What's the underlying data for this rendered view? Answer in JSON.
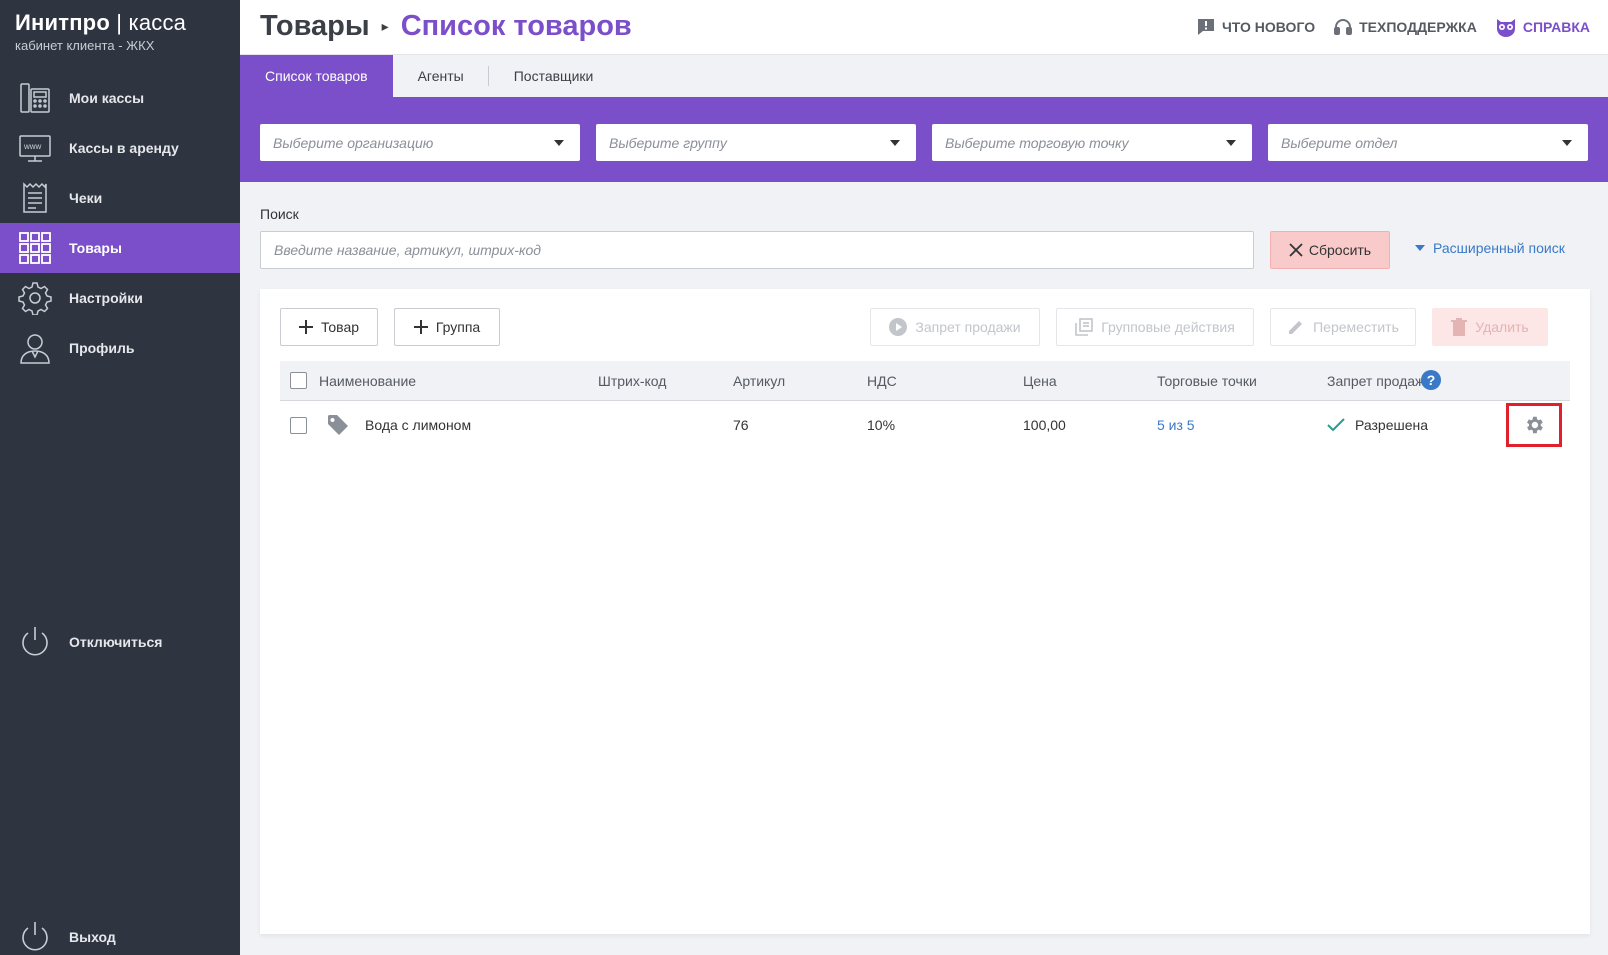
{
  "sidebar": {
    "brand_main": "Инитпро",
    "brand_sep": " | ",
    "brand_sub_word": "касса",
    "brand_subtitle": "кабинет клиента - ЖКХ",
    "items": [
      {
        "label": "Мои кассы",
        "icon": "cash-register-icon"
      },
      {
        "label": "Кассы в аренду",
        "icon": "www-terminal-icon"
      },
      {
        "label": "Чеки",
        "icon": "receipt-icon"
      },
      {
        "label": "Товары",
        "icon": "grid-icon",
        "active": true
      },
      {
        "label": "Настройки",
        "icon": "gear-icon"
      },
      {
        "label": "Профиль",
        "icon": "user-icon"
      }
    ],
    "disconnect_label": "Отключиться",
    "logout_label": "Выход"
  },
  "header": {
    "breadcrumb_root": "Товары",
    "breadcrumb_sep": "▸",
    "breadcrumb_current": "Список товаров",
    "links": {
      "news": "ЧТО НОВОГО",
      "support": "ТЕХПОДДЕРЖКА",
      "help": "СПРАВКА"
    }
  },
  "tabs": [
    {
      "label": "Список товаров",
      "active": true
    },
    {
      "label": "Агенты"
    },
    {
      "label": "Поставщики"
    }
  ],
  "filters": {
    "organization_placeholder": "Выберите организацию",
    "group_placeholder": "Выберите группу",
    "point_placeholder": "Выберите торговую точку",
    "department_placeholder": "Выберите отдел"
  },
  "search": {
    "label": "Поиск",
    "placeholder": "Введите название, артикул, штрих-код",
    "value": "",
    "reset_label": "Сбросить",
    "advanced_label": "Расширенный поиск"
  },
  "toolbar": {
    "add_product": "Товар",
    "add_group": "Группа",
    "ban_sale": "Запрет продажи",
    "group_actions": "Групповые действия",
    "move": "Переместить",
    "delete": "Удалить"
  },
  "table": {
    "columns": {
      "name": "Наименование",
      "barcode": "Штрих-код",
      "article": "Артикул",
      "vat": "НДС",
      "price": "Цена",
      "points": "Торговые точки",
      "ban": "Запрет продажи",
      "help": "?"
    },
    "rows": [
      {
        "name": "Вода с лимоном",
        "barcode": "",
        "article": "76",
        "vat": "10%",
        "price": "100,00",
        "points": "5 из 5",
        "ban": "Разрешена"
      }
    ]
  },
  "colors": {
    "accent": "#7b4fc9",
    "sidebar": "#2e3440",
    "link": "#3a79c8",
    "reset_bg": "#f9caca",
    "highlight": "#e0202a"
  }
}
